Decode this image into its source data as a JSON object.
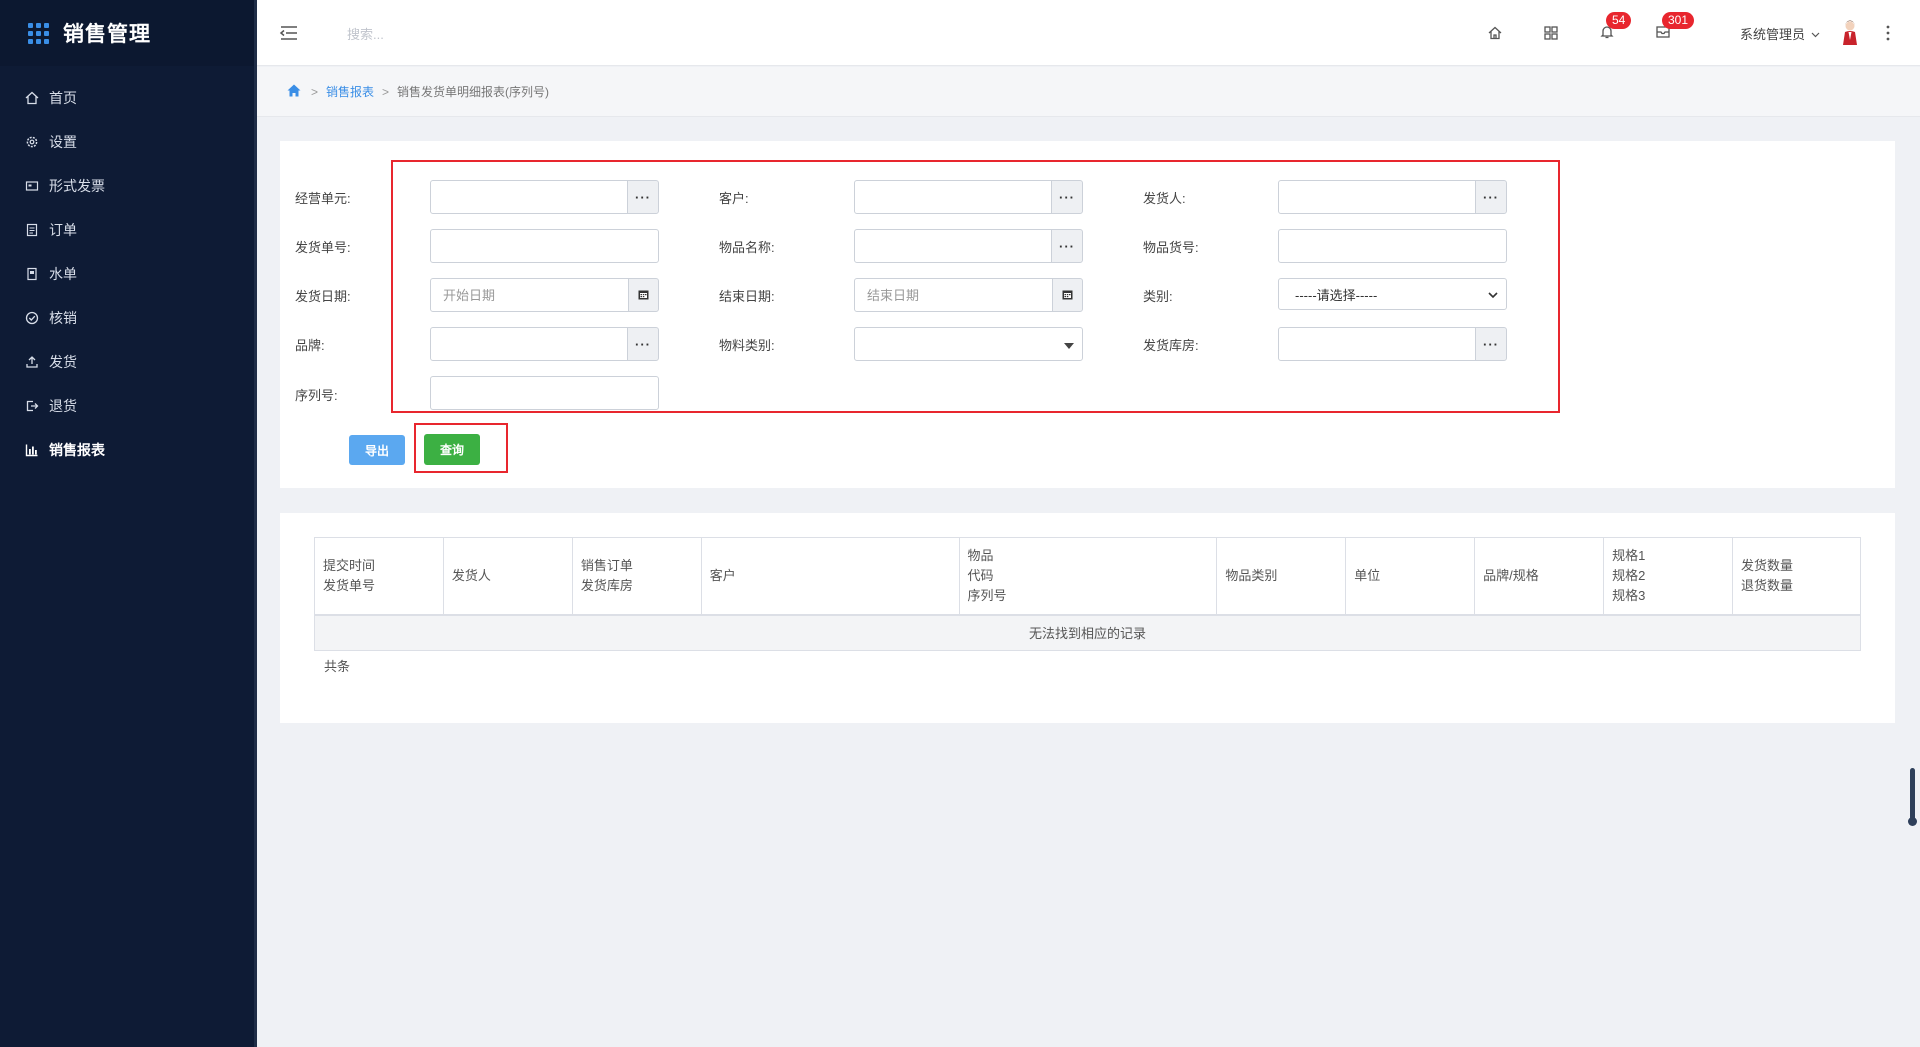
{
  "app": {
    "title": "销售管理"
  },
  "sidebar": {
    "items": [
      {
        "label": "首页",
        "icon": "home-icon"
      },
      {
        "label": "设置",
        "icon": "gear-icon"
      },
      {
        "label": "形式发票",
        "icon": "invoice-icon"
      },
      {
        "label": "订单",
        "icon": "order-icon"
      },
      {
        "label": "水单",
        "icon": "receipt-icon"
      },
      {
        "label": "核销",
        "icon": "check-circle-icon"
      },
      {
        "label": "发货",
        "icon": "upload-icon"
      },
      {
        "label": "退货",
        "icon": "exit-icon"
      },
      {
        "label": "销售报表",
        "icon": "bar-chart-icon",
        "active": true
      }
    ]
  },
  "topbar": {
    "search_placeholder": "搜索...",
    "notifications_count": "54",
    "messages_count": "301",
    "user_name": "系统管理员"
  },
  "breadcrumb": {
    "parent": "销售报表",
    "current": "销售发货单明细报表(序列号)"
  },
  "filters": {
    "business_unit_label": "经营单元:",
    "customer_label": "客户:",
    "shipper_label": "发货人:",
    "ship_no_label": "发货单号:",
    "item_name_label": "物品名称:",
    "item_code_label": "物品货号:",
    "ship_date_label": "发货日期:",
    "start_date_placeholder": "开始日期",
    "end_date_label": "结束日期:",
    "end_date_placeholder": "结束日期",
    "category_label": "类别:",
    "category_value": "-----请选择-----",
    "brand_label": "品牌:",
    "material_category_label": "物料类别:",
    "warehouse_label": "发货库房:",
    "serial_label": "序列号:",
    "addon_dots": "···"
  },
  "actions": {
    "export_label": "导出",
    "query_label": "查询"
  },
  "table": {
    "headers": [
      "提交时间\n发货单号",
      "发货人",
      "销售订单\n发货库房",
      "客户",
      "物品\n代码\n序列号",
      "物品类别",
      "单位",
      "品牌/规格",
      "规格1\n规格2\n规格3",
      "发货数量\n退货数量"
    ],
    "empty_text": "无法找到相应的记录",
    "total_text": "共条"
  },
  "colors": {
    "sidebar_bg": "#0e1b35",
    "accent": "#3a8ee6",
    "query_button": "#3cb043",
    "export_button": "#5ba8f0",
    "highlight_box": "#e8262e",
    "badge": "#e8262e"
  }
}
